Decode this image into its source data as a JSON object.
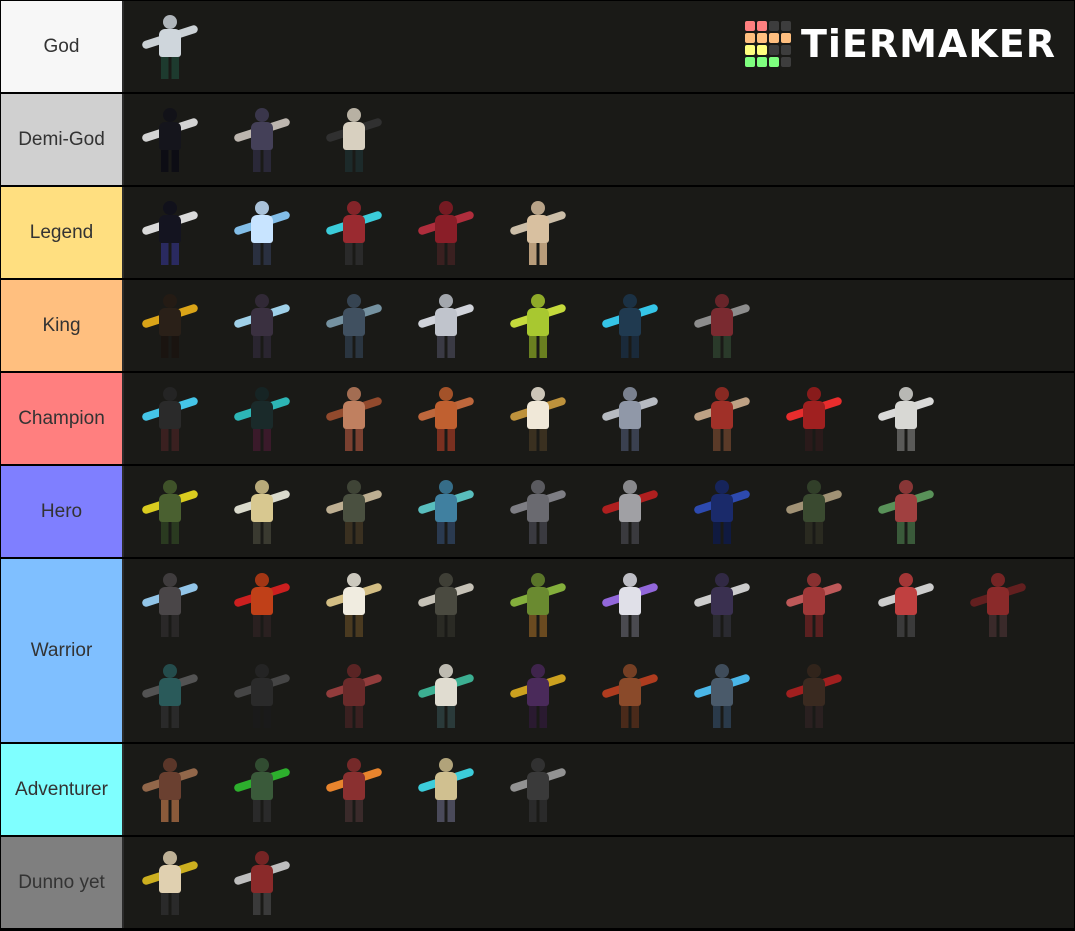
{
  "logo": {
    "text": "TiERMAKER",
    "grid_colors": [
      "#ff7f7f",
      "#ff7f7f",
      "#3d3d3d",
      "#3d3d3d",
      "#ffbf7f",
      "#ffbf7f",
      "#ffbf7f",
      "#ffbf7f",
      "#ffff7f",
      "#ffff7f",
      "#3d3d3d",
      "#3d3d3d",
      "#7fff7f",
      "#7fff7f",
      "#7fff7f",
      "#3d3d3d"
    ]
  },
  "tiers": [
    {
      "label": "God",
      "color": "#f7f7f7",
      "text_color": "#333333",
      "rows": 1,
      "items": [
        {
          "name": "silver-armored-axe-knight",
          "c1": "#cfd6dc",
          "c2": "#1d3a2e",
          "acc": "#dfe6ea"
        }
      ]
    },
    {
      "label": "Demi-God",
      "color": "#d0d0d0",
      "text_color": "#333333",
      "rows": 1,
      "items": [
        {
          "name": "shadow-greatsword",
          "c1": "#15151c",
          "c2": "#0d0d14",
          "acc": "#e8e8e8"
        },
        {
          "name": "bat-winged-demon",
          "c1": "#444058",
          "c2": "#2a2838",
          "acc": "#cfc8c0"
        },
        {
          "name": "hooded-reaper",
          "c1": "#d8d0c0",
          "c2": "#1c2a2a",
          "acc": "#333"
        }
      ]
    },
    {
      "label": "Legend",
      "color": "#ffdf80",
      "text_color": "#333333",
      "rows": 1,
      "items": [
        {
          "name": "void-scythe",
          "c1": "#141420",
          "c2": "#2a2a60",
          "acc": "#f0f0f0"
        },
        {
          "name": "ice-spear-knight",
          "c1": "#c8e4ff",
          "c2": "#2a3040",
          "acc": "#8fd0ff"
        },
        {
          "name": "cyan-blade-rogue",
          "c1": "#9a2a30",
          "c2": "#2a2a2a",
          "acc": "#3fe0f0"
        },
        {
          "name": "crimson-warlord",
          "c1": "#8a1e28",
          "c2": "#3a2020",
          "acc": "#c03040"
        },
        {
          "name": "wolf-rider",
          "c1": "#d8c0a0",
          "c2": "#b89c7a",
          "acc": "#e0d0b8"
        }
      ]
    },
    {
      "label": "King",
      "color": "#ffbf7f",
      "text_color": "#333333",
      "rows": 1,
      "items": [
        {
          "name": "golden-moth-wings",
          "c1": "#2a2018",
          "c2": "#1a1410",
          "acc": "#f0b418"
        },
        {
          "name": "ice-dual-blades",
          "c1": "#3a3040",
          "c2": "#2a2530",
          "acc": "#aee4ff"
        },
        {
          "name": "spearman",
          "c1": "#405060",
          "c2": "#2a3540",
          "acc": "#80a0b0"
        },
        {
          "name": "silver-winged-paladin",
          "c1": "#c0c4cc",
          "c2": "#3a3a44",
          "acc": "#e4e8f0"
        },
        {
          "name": "lime-druid",
          "c1": "#a8c830",
          "c2": "#6a8020",
          "acc": "#d8f040"
        },
        {
          "name": "cyan-frost-knight",
          "c1": "#203a50",
          "c2": "#1a2a3a",
          "acc": "#38d8ff"
        },
        {
          "name": "dual-sword-fighter",
          "c1": "#7a2a30",
          "c2": "#2a3a2a",
          "acc": "#9a9a9a"
        }
      ]
    },
    {
      "label": "Champion",
      "color": "#ff7f7f",
      "text_color": "#333333",
      "rows": 1,
      "items": [
        {
          "name": "cyan-bow-archer",
          "c1": "#2a2a2a",
          "c2": "#3a2020",
          "acc": "#4ad8ff"
        },
        {
          "name": "teal-scythe-assassin",
          "c1": "#1a2a2a",
          "c2": "#3a1a2a",
          "acc": "#30c8c8"
        },
        {
          "name": "spear-dancer",
          "c1": "#c08060",
          "c2": "#7a4030",
          "acc": "#a05030"
        },
        {
          "name": "orange-brawler",
          "c1": "#c06030",
          "c2": "#7a3020",
          "acc": "#d07040"
        },
        {
          "name": "white-coat-gunner",
          "c1": "#f0e8d8",
          "c2": "#3a3020",
          "acc": "#d0a040"
        },
        {
          "name": "wolf-blade",
          "c1": "#9098a8",
          "c2": "#3a4050",
          "acc": "#c8ccd4"
        },
        {
          "name": "red-cape-archer",
          "c1": "#a03028",
          "c2": "#5a3a28",
          "acc": "#d0b090"
        },
        {
          "name": "flame-mage",
          "c1": "#a02020",
          "c2": "#2a1a1a",
          "acc": "#ff3030"
        },
        {
          "name": "white-hat-wanderer",
          "c1": "#d8d8d4",
          "c2": "#5a5a58",
          "acc": "#f0f0ee"
        }
      ]
    },
    {
      "label": "Hero",
      "color": "#7f7fff",
      "text_color": "#333333",
      "rows": 1,
      "items": [
        {
          "name": "angel-greatsword",
          "c1": "#4a6030",
          "c2": "#2a3a20",
          "acc": "#f0e020"
        },
        {
          "name": "staff-acolyte",
          "c1": "#d8c890",
          "c2": "#3a3a30",
          "acc": "#f0f0e0"
        },
        {
          "name": "sickle-rogue",
          "c1": "#4a5040",
          "c2": "#3a3020",
          "acc": "#d0c0a0"
        },
        {
          "name": "teal-winged-fighter",
          "c1": "#4080a0",
          "c2": "#2a3a50",
          "acc": "#60d0d0"
        },
        {
          "name": "brawler-monk",
          "c1": "#6a6a70",
          "c2": "#3a3a40",
          "acc": "#8a8a90"
        },
        {
          "name": "red-blade-ninja",
          "c1": "#a0a0a4",
          "c2": "#3a3a3e",
          "acc": "#c02020"
        },
        {
          "name": "blue-armored-knight",
          "c1": "#1a2a6a",
          "c2": "#101a40",
          "acc": "#3050c0"
        },
        {
          "name": "green-cloak-archer",
          "c1": "#3a4a30",
          "c2": "#2a2a20",
          "acc": "#b0a080"
        },
        {
          "name": "green-red-gladiator",
          "c1": "#a04040",
          "c2": "#3a5a3a",
          "acc": "#60a060"
        }
      ]
    },
    {
      "label": "Warrior",
      "color": "#7fbfff",
      "text_color": "#333333",
      "rows": 2,
      "items": [
        {
          "name": "ice-sword-shield",
          "c1": "#4a4648",
          "c2": "#2a2828",
          "acc": "#a0d8ff"
        },
        {
          "name": "fire-warrior",
          "c1": "#c04018",
          "c2": "#2a2020",
          "acc": "#e02020"
        },
        {
          "name": "white-robe-cleric",
          "c1": "#f0ece0",
          "c2": "#4a3a20",
          "acc": "#e8d090"
        },
        {
          "name": "feather-winged-angel",
          "c1": "#4a4a40",
          "c2": "#2a2a24",
          "acc": "#d8d4c8"
        },
        {
          "name": "leaf-druid",
          "c1": "#6a8a30",
          "c2": "#6a4a20",
          "acc": "#90c040"
        },
        {
          "name": "violet-blade-monk",
          "c1": "#e0e0e8",
          "c2": "#4a4a50",
          "acc": "#a070f0"
        },
        {
          "name": "purple-longsword",
          "c1": "#3a3050",
          "c2": "#2a2a30",
          "acc": "#e0e0e0"
        },
        {
          "name": "red-spellbook-mage",
          "c1": "#a03838",
          "c2": "#5a2020",
          "acc": "#d06060"
        },
        {
          "name": "red-bandana-swordsman",
          "c1": "#c04040",
          "c2": "#3a3a3a",
          "acc": "#e0e0e0"
        },
        {
          "name": "crimson-shield-guard",
          "c1": "#8a2a2a",
          "c2": "#3a2a2a",
          "acc": "#6a2020"
        },
        {
          "name": "teal-hooded-rogue",
          "c1": "#2a5a5a",
          "c2": "#2a2a2a",
          "acc": "#5a5a5a"
        },
        {
          "name": "black-greatsword",
          "c1": "#2a2a2a",
          "c2": "#1a1a1a",
          "acc": "#4a4a4a"
        },
        {
          "name": "red-bladed-duelist",
          "c1": "#6a2a2a",
          "c2": "#3a2020",
          "acc": "#a04040"
        },
        {
          "name": "teal-skirt-dancer",
          "c1": "#e0dcd0",
          "c2": "#2a3a3a",
          "acc": "#40c0a0"
        },
        {
          "name": "gold-purple-sorcerer",
          "c1": "#4a2a5a",
          "c2": "#2a1a30",
          "acc": "#e0b020"
        },
        {
          "name": "bearded-axeman",
          "c1": "#8a4a2a",
          "c2": "#4a2a1a",
          "acc": "#c04020"
        },
        {
          "name": "lightning-knight",
          "c1": "#4a5a6a",
          "c2": "#2a3a4a",
          "acc": "#50c8ff"
        },
        {
          "name": "red-shield-greatsword",
          "c1": "#3a2a20",
          "c2": "#2a2020",
          "acc": "#b02020"
        }
      ]
    },
    {
      "label": "Adventurer",
      "color": "#7fffff",
      "text_color": "#333333",
      "rows": 1,
      "items": [
        {
          "name": "brown-coat-adventurer",
          "c1": "#6a4030",
          "c2": "#8a5a3a",
          "acc": "#a07050"
        },
        {
          "name": "green-glove-brawler",
          "c1": "#3a5a3a",
          "c2": "#2a2a2a",
          "acc": "#30c030"
        },
        {
          "name": "butterfly-fairy",
          "c1": "#8a3030",
          "c2": "#3a2a2a",
          "acc": "#ff9030"
        },
        {
          "name": "cyan-orb-monk",
          "c1": "#d0c090",
          "c2": "#4a4a5a",
          "acc": "#40e0f0"
        },
        {
          "name": "dark-knight-sword",
          "c1": "#3a3a3a",
          "c2": "#2a2a2a",
          "acc": "#a0a0a0"
        }
      ]
    },
    {
      "label": "Dunno yet",
      "color": "#7f7f7f",
      "text_color": "#333333",
      "rows": 1,
      "items": [
        {
          "name": "golden-axe-gunner",
          "c1": "#e0d0b0",
          "c2": "#2a2a2a",
          "acc": "#e0c020"
        },
        {
          "name": "red-masked-fighter",
          "c1": "#8a2a2a",
          "c2": "#3a3a3a",
          "acc": "#d0d0d0"
        }
      ]
    }
  ]
}
